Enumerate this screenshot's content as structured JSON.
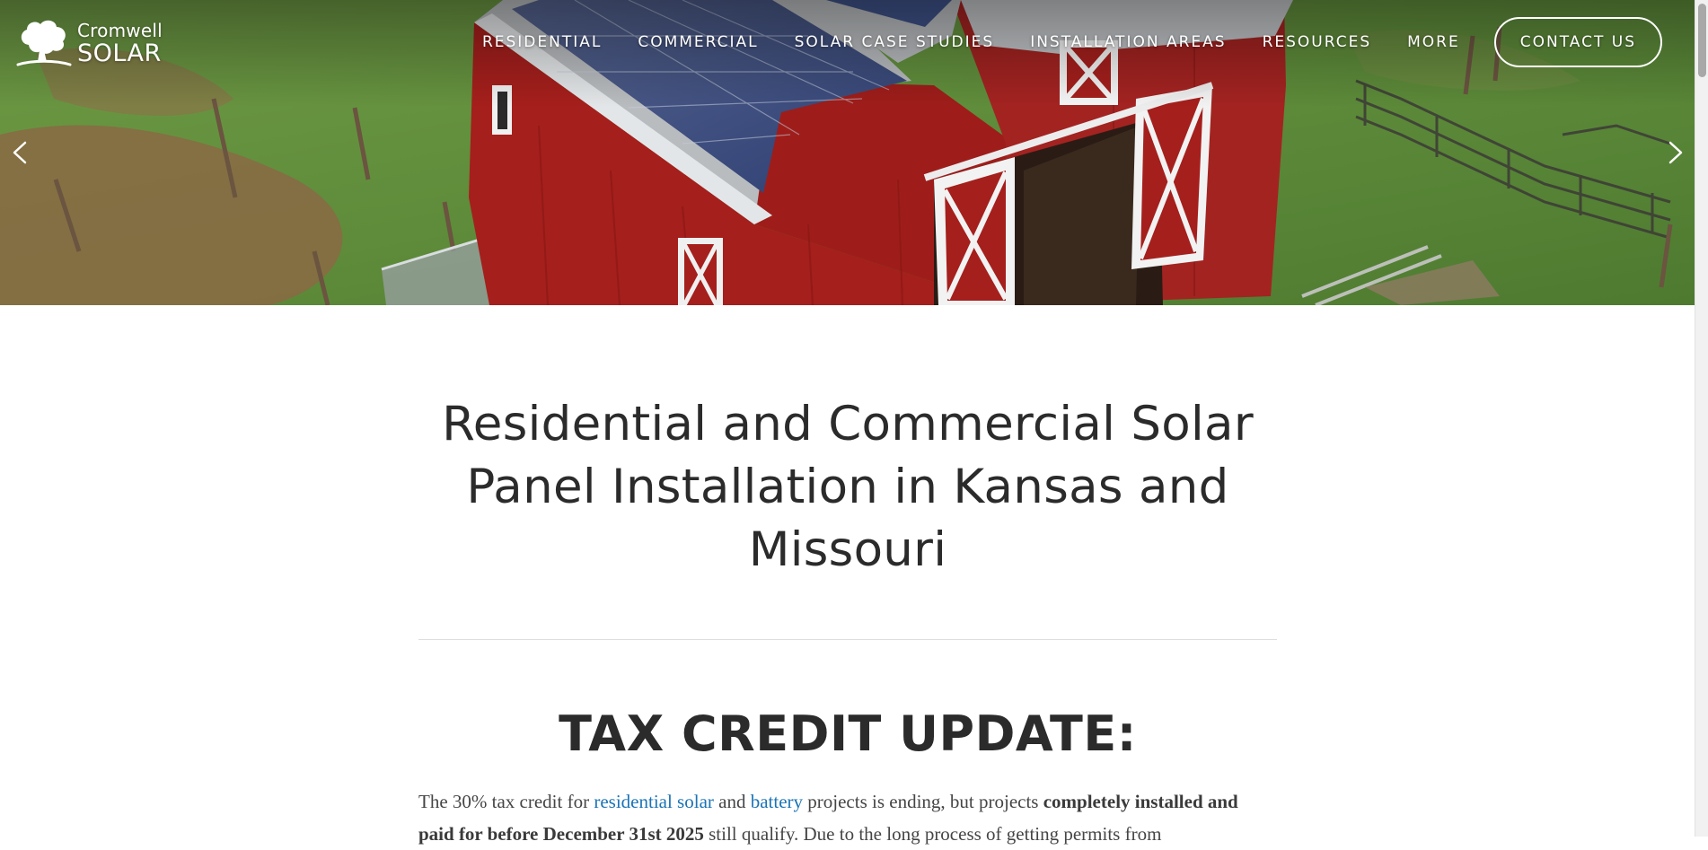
{
  "header": {
    "logo": {
      "line1": "Cromwell",
      "line2": "SOLAR"
    },
    "nav": [
      "RESIDENTIAL",
      "COMMERCIAL",
      "SOLAR CASE STUDIES",
      "INSTALLATION AREAS",
      "RESOURCES",
      "MORE"
    ],
    "contact_label": "CONTACT US"
  },
  "hero": {
    "icons": {
      "prev": "chevron-left-icon",
      "next": "chevron-right-icon"
    },
    "colors": {
      "grass": "#5d8a3a",
      "barn_red": "#a51f1c",
      "roof_gray": "#b9bcbf",
      "panel_blue": "#3b4f82"
    }
  },
  "main": {
    "title": "Residential and Commercial Solar Panel Installation in Kansas and Missouri",
    "section_title": "TAX CREDIT UPDATE:",
    "paragraph": {
      "p1": "The 30% tax credit for ",
      "link1": "residential solar",
      "p2": " and ",
      "link2": "battery",
      "p3": " projects is ending, but projects ",
      "bold1": "completely installed and paid for before December 31st 2025",
      "p4": " still qualify. Due to the long process of getting permits from"
    },
    "link_color": "#1a73b5"
  }
}
